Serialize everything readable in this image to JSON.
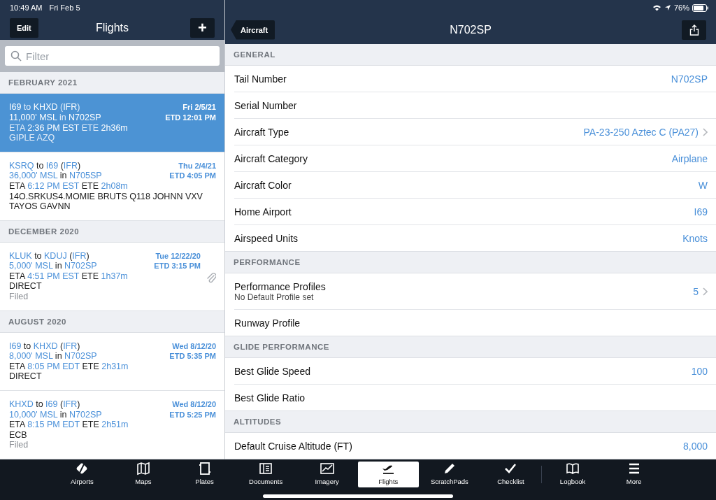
{
  "status_bar": {
    "time": "10:49 AM",
    "date": "Fri Feb 5",
    "battery": "76%"
  },
  "flights_pane": {
    "title": "Flights",
    "edit_button": "Edit",
    "add_button": "+",
    "filter": {
      "placeholder": "Filter"
    },
    "sections": [
      {
        "header": "FEBRUARY 2021",
        "flights": [
          {
            "selected": true,
            "attachment": false,
            "date": "Fri 2/5/21",
            "etd": "ETD 12:01 PM",
            "lines": [
              [
                {
                  "text": "I69",
                  "highlight": true
                },
                {
                  "text": " to ",
                  "highlight": false
                },
                {
                  "text": "KHXD",
                  "highlight": true
                },
                {
                  "text": " (",
                  "highlight": false
                },
                {
                  "text": "IFR",
                  "highlight": true
                },
                {
                  "text": ")",
                  "highlight": false
                }
              ],
              [
                {
                  "text": "11,000' MSL",
                  "highlight": true
                },
                {
                  "text": " in ",
                  "highlight": false
                },
                {
                  "text": "N702SP",
                  "highlight": true
                }
              ],
              [
                {
                  "text": "ETA ",
                  "highlight": false
                },
                {
                  "text": "2:36 PM EST",
                  "highlight": true
                },
                {
                  "text": " ETE ",
                  "highlight": false
                },
                {
                  "text": "2h36m",
                  "highlight": true
                }
              ],
              [
                {
                  "text": "GIPLE AZQ",
                  "highlight": false
                }
              ]
            ]
          },
          {
            "selected": false,
            "attachment": false,
            "date": "Thu 2/4/21",
            "etd": "ETD 4:05 PM",
            "lines": [
              [
                {
                  "text": "KSRQ",
                  "highlight": true
                },
                {
                  "text": " to ",
                  "highlight": false
                },
                {
                  "text": "I69",
                  "highlight": true
                },
                {
                  "text": " (",
                  "highlight": false
                },
                {
                  "text": "IFR",
                  "highlight": true
                },
                {
                  "text": ")",
                  "highlight": false
                }
              ],
              [
                {
                  "text": "36,000' MSL",
                  "highlight": true
                },
                {
                  "text": " in ",
                  "highlight": false
                },
                {
                  "text": "N705SP",
                  "highlight": true
                }
              ],
              [
                {
                  "text": "ETA ",
                  "highlight": false
                },
                {
                  "text": "6:12 PM EST",
                  "highlight": true
                },
                {
                  "text": " ETE ",
                  "highlight": false
                },
                {
                  "text": "2h08m",
                  "highlight": true
                }
              ],
              [
                {
                  "text": "14O.SRKUS4.MOMIE BRUTS Q118 JOHNN VXV",
                  "highlight": false
                }
              ],
              [
                {
                  "text": "TAYOS GAVNN",
                  "highlight": false
                }
              ]
            ]
          }
        ]
      },
      {
        "header": "DECEMBER 2020",
        "flights": [
          {
            "selected": false,
            "attachment": true,
            "date": "Tue 12/22/20",
            "etd": "ETD 3:15 PM",
            "status": "Filed",
            "lines": [
              [
                {
                  "text": "KLUK",
                  "highlight": true
                },
                {
                  "text": " to ",
                  "highlight": false
                },
                {
                  "text": "KDUJ",
                  "highlight": true
                },
                {
                  "text": " (",
                  "highlight": false
                },
                {
                  "text": "IFR",
                  "highlight": true
                },
                {
                  "text": ")",
                  "highlight": false
                }
              ],
              [
                {
                  "text": "5,000' MSL",
                  "highlight": true
                },
                {
                  "text": " in ",
                  "highlight": false
                },
                {
                  "text": "N702SP",
                  "highlight": true
                }
              ],
              [
                {
                  "text": "ETA ",
                  "highlight": false
                },
                {
                  "text": "4:51 PM EST",
                  "highlight": true
                },
                {
                  "text": " ETE ",
                  "highlight": false
                },
                {
                  "text": "1h37m",
                  "highlight": true
                }
              ],
              [
                {
                  "text": "DIRECT",
                  "highlight": false
                }
              ]
            ]
          }
        ]
      },
      {
        "header": "AUGUST 2020",
        "flights": [
          {
            "selected": false,
            "attachment": false,
            "date": "Wed 8/12/20",
            "etd": "ETD 5:35 PM",
            "lines": [
              [
                {
                  "text": "I69",
                  "highlight": true
                },
                {
                  "text": " to ",
                  "highlight": false
                },
                {
                  "text": "KHXD",
                  "highlight": true
                },
                {
                  "text": " (",
                  "highlight": false
                },
                {
                  "text": "IFR",
                  "highlight": true
                },
                {
                  "text": ")",
                  "highlight": false
                }
              ],
              [
                {
                  "text": "8,000' MSL",
                  "highlight": true
                },
                {
                  "text": " in ",
                  "highlight": false
                },
                {
                  "text": "N702SP",
                  "highlight": true
                }
              ],
              [
                {
                  "text": "ETA ",
                  "highlight": false
                },
                {
                  "text": "8:05 PM EDT",
                  "highlight": true
                },
                {
                  "text": " ETE ",
                  "highlight": false
                },
                {
                  "text": "2h31m",
                  "highlight": true
                }
              ],
              [
                {
                  "text": "DIRECT",
                  "highlight": false
                }
              ]
            ]
          },
          {
            "selected": false,
            "attachment": false,
            "date": "Wed 8/12/20",
            "etd": "ETD 5:25 PM",
            "status": "Filed",
            "lines": [
              [
                {
                  "text": "KHXD",
                  "highlight": true
                },
                {
                  "text": " to ",
                  "highlight": false
                },
                {
                  "text": "I69",
                  "highlight": true
                },
                {
                  "text": " (",
                  "highlight": false
                },
                {
                  "text": "IFR",
                  "highlight": true
                },
                {
                  "text": ")",
                  "highlight": false
                }
              ],
              [
                {
                  "text": "10,000' MSL",
                  "highlight": true
                },
                {
                  "text": " in ",
                  "highlight": false
                },
                {
                  "text": "N702SP",
                  "highlight": true
                }
              ],
              [
                {
                  "text": "ETA ",
                  "highlight": false
                },
                {
                  "text": "8:15 PM EDT",
                  "highlight": true
                },
                {
                  "text": " ETE ",
                  "highlight": false
                },
                {
                  "text": "2h51m",
                  "highlight": true
                }
              ],
              [
                {
                  "text": "ECB",
                  "highlight": false
                }
              ]
            ]
          }
        ]
      }
    ]
  },
  "aircraft_pane": {
    "back_button": "Aircraft",
    "title": "N702SP",
    "sections": [
      {
        "header": "GENERAL",
        "rows": [
          {
            "label": "Tail Number",
            "value": "N702SP",
            "chevron": false
          },
          {
            "label": "Serial Number",
            "chevron": false
          },
          {
            "label": "Aircraft Type",
            "value": "PA-23-250 Aztec C (PA27)",
            "chevron": true
          },
          {
            "label": "Aircraft Category",
            "value": "Airplane",
            "chevron": false
          },
          {
            "label": "Aircraft Color",
            "value": "W",
            "chevron": false
          },
          {
            "label": "Home Airport",
            "value": "I69",
            "chevron": false
          },
          {
            "label": "Airspeed Units",
            "value": "Knots",
            "chevron": false
          }
        ]
      },
      {
        "header": "PERFORMANCE",
        "rows": [
          {
            "label": "Performance Profiles",
            "subtitle": "No Default Profile set",
            "value": "5",
            "chevron": true
          },
          {
            "label": "Runway Profile",
            "chevron": false
          }
        ]
      },
      {
        "header": "GLIDE PERFORMANCE",
        "rows": [
          {
            "label": "Best Glide Speed",
            "value": "100",
            "chevron": false
          },
          {
            "label": "Best Glide Ratio",
            "chevron": false
          }
        ]
      },
      {
        "header": "ALTITUDES",
        "rows": [
          {
            "label": "Default Cruise Altitude (FT)",
            "value": "8,000",
            "chevron": false
          }
        ]
      }
    ]
  },
  "tab_bar": [
    {
      "label": "Airports",
      "selected": false
    },
    {
      "label": "Maps",
      "selected": false
    },
    {
      "label": "Plates",
      "selected": false
    },
    {
      "label": "Documents",
      "selected": false
    },
    {
      "label": "Imagery",
      "selected": false
    },
    {
      "label": "Flights",
      "selected": true
    },
    {
      "label": "ScratchPads",
      "selected": false
    },
    {
      "label": "Checklist",
      "selected": false
    },
    {
      "label": "Logbook",
      "selected": false
    },
    {
      "label": "More",
      "selected": false
    }
  ]
}
